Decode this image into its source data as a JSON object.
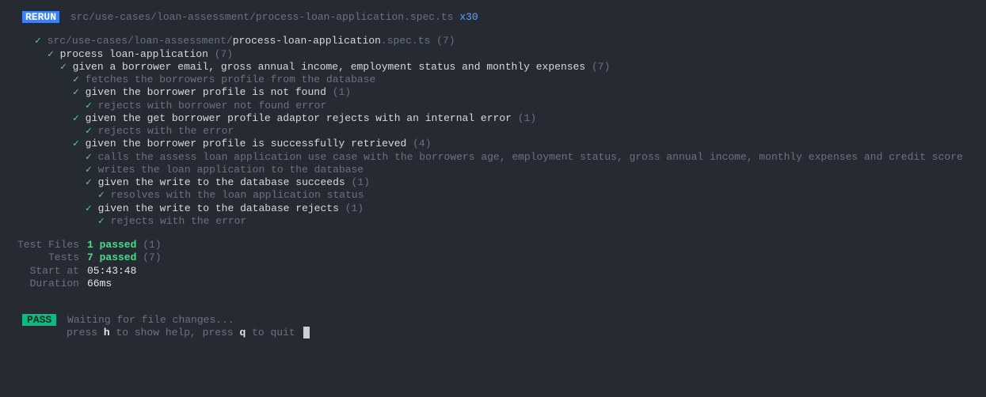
{
  "header": {
    "badge": "RERUN",
    "file": "src/use-cases/loan-assessment/process-loan-application.spec.ts",
    "runs": "x30"
  },
  "filePath": {
    "prefix": "src/use-cases/loan-assessment/",
    "name": "process-loan-application",
    "suffix": ".spec.ts",
    "count": "(7)"
  },
  "root": {
    "text": "process loan-application",
    "count": "(7)"
  },
  "given": {
    "text": "given a borrower email, gross annual income, employment status and monthly expenses",
    "count": "(7)"
  },
  "t1": "fetches the borrowers profile from the database",
  "g1": {
    "text": "given the borrower profile is not found",
    "count": "(1)"
  },
  "t2": "rejects with borrower not found error",
  "g2": {
    "text": "given the get borrower profile adaptor rejects with an internal error",
    "count": "(1)"
  },
  "t3": "rejects with the error",
  "g3": {
    "text": "given the borrower profile is successfully retrieved",
    "count": "(4)"
  },
  "t4": "calls the assess loan application use case with the borrowers age, employment status, gross annual income, monthly expenses and credit score",
  "t5": "writes the loan application to the database",
  "g4": {
    "text": "given the write to the database succeeds",
    "count": "(1)"
  },
  "t6": "resolves with the loan application status",
  "g5": {
    "text": "given the write to the database rejects",
    "count": "(1)"
  },
  "t7": "rejects with the error",
  "summary": {
    "testFilesLabel": "Test Files",
    "testFiles": "1 passed",
    "testFilesCount": "(1)",
    "testsLabel": "Tests",
    "tests": "7 passed",
    "testsCount": "(7)",
    "startLabel": "Start at",
    "start": "05:43:48",
    "durationLabel": "Duration",
    "duration": "66ms"
  },
  "watch": {
    "badge": "PASS",
    "message": "Waiting for file changes...",
    "hintPrefix1": "press ",
    "key1": "h",
    "hintMid": " to show help, press ",
    "key2": "q",
    "hintSuffix": " to quit"
  }
}
